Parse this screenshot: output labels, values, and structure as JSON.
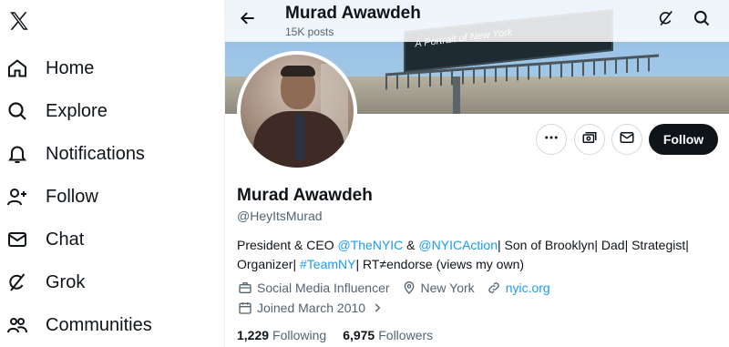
{
  "sidebar": {
    "logo_icon": "x-logo-icon",
    "items": [
      {
        "label": "Home",
        "icon": "home-icon"
      },
      {
        "label": "Explore",
        "icon": "search-icon"
      },
      {
        "label": "Notifications",
        "icon": "bell-icon"
      },
      {
        "label": "Follow",
        "icon": "person-add-icon"
      },
      {
        "label": "Chat",
        "icon": "mail-icon"
      },
      {
        "label": "Grok",
        "icon": "grok-icon"
      },
      {
        "label": "Communities",
        "icon": "people-icon"
      }
    ]
  },
  "header": {
    "name": "Murad Awawdeh",
    "posts": "15K posts"
  },
  "banner": {
    "billboard_text": "A Portrait of New York"
  },
  "actions": {
    "follow_label": "Follow"
  },
  "profile": {
    "display_name": "Murad Awawdeh",
    "handle": "@HeyItsMurad",
    "bio": {
      "t1": "President & CEO ",
      "m1": "@TheNYIC",
      "t2": " & ",
      "m2": "@NYICAction",
      "t3": "| Son of Brooklyn| Dad| Strategist| Organizer| ",
      "m3": "#TeamNY",
      "t4": "| RT≠endorse (views my own)"
    },
    "category": "Social Media Influencer",
    "location": "New York",
    "website": "nyic.org",
    "joined": "Joined March 2010",
    "following_count": "1,229",
    "following_label": "Following",
    "followers_count": "6,975",
    "followers_label": "Followers"
  },
  "colors": {
    "accent": "#1d9bf0",
    "text": "#0f1419",
    "muted": "#536471",
    "button_dark": "#0f1419"
  }
}
